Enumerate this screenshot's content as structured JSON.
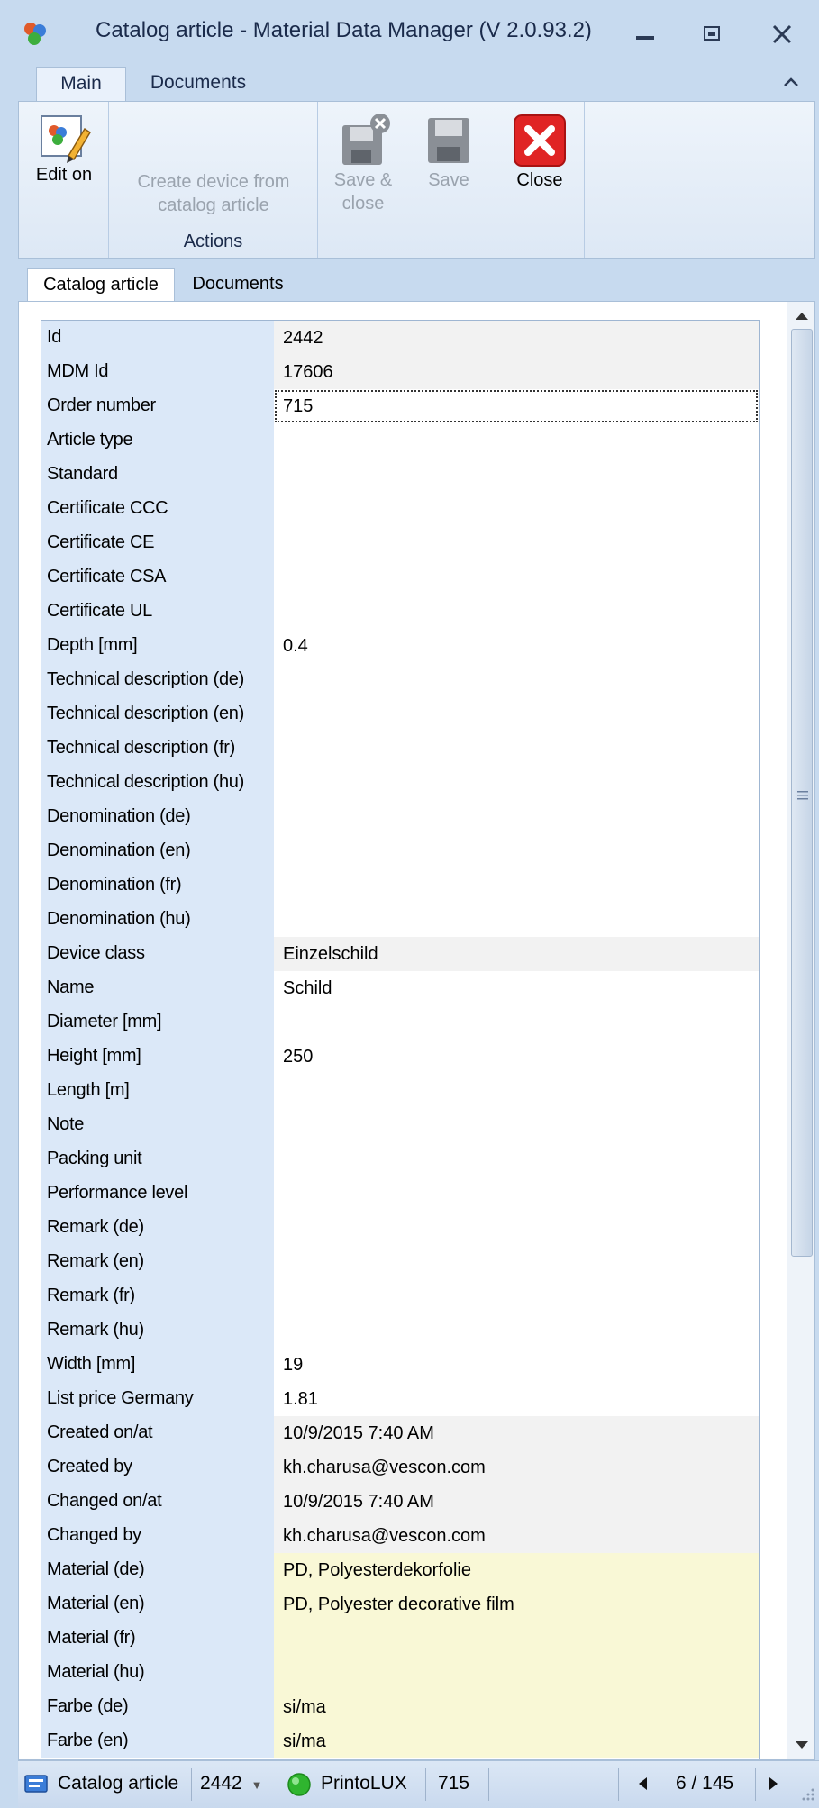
{
  "window": {
    "title": "Catalog article - Material Data Manager (V 2.0.93.2)"
  },
  "ribbon": {
    "tabs": [
      "Main",
      "Documents"
    ],
    "buttons": {
      "edit_on": "Edit on",
      "create_device_line1": "Create device from",
      "create_device_line2": "catalog article",
      "save_close_line1": "Save &",
      "save_close_line2": "close",
      "save": "Save",
      "close": "Close"
    },
    "group_actions": "Actions"
  },
  "content_tabs": [
    "Catalog article",
    "Documents"
  ],
  "fields": [
    {
      "label": "Id",
      "value": "2442",
      "style": "ro"
    },
    {
      "label": "MDM Id",
      "value": "17606",
      "style": "ro"
    },
    {
      "label": "Order number",
      "value": "715",
      "style": "focus"
    },
    {
      "label": "Article type",
      "value": "",
      "style": ""
    },
    {
      "label": "Standard",
      "value": "",
      "style": ""
    },
    {
      "label": "Certificate CCC",
      "value": "",
      "style": ""
    },
    {
      "label": "Certificate CE",
      "value": "",
      "style": ""
    },
    {
      "label": "Certificate CSA",
      "value": "",
      "style": ""
    },
    {
      "label": "Certificate UL",
      "value": "",
      "style": ""
    },
    {
      "label": "Depth [mm]",
      "value": "0.4",
      "style": ""
    },
    {
      "label": "Technical description (de)",
      "value": "",
      "style": ""
    },
    {
      "label": "Technical description (en)",
      "value": "",
      "style": ""
    },
    {
      "label": "Technical description (fr)",
      "value": "",
      "style": ""
    },
    {
      "label": "Technical description (hu)",
      "value": "",
      "style": ""
    },
    {
      "label": "Denomination (de)",
      "value": "",
      "style": ""
    },
    {
      "label": "Denomination (en)",
      "value": "",
      "style": ""
    },
    {
      "label": "Denomination (fr)",
      "value": "",
      "style": ""
    },
    {
      "label": "Denomination (hu)",
      "value": "",
      "style": ""
    },
    {
      "label": "Device class",
      "value": "Einzelschild",
      "style": "ro"
    },
    {
      "label": "Name",
      "value": "Schild",
      "style": ""
    },
    {
      "label": "Diameter [mm]",
      "value": "",
      "style": ""
    },
    {
      "label": "Height [mm]",
      "value": "250",
      "style": ""
    },
    {
      "label": "Length [m]",
      "value": "",
      "style": ""
    },
    {
      "label": "Note",
      "value": "",
      "style": ""
    },
    {
      "label": "Packing unit",
      "value": "",
      "style": ""
    },
    {
      "label": "Performance level",
      "value": "",
      "style": ""
    },
    {
      "label": "Remark (de)",
      "value": "",
      "style": ""
    },
    {
      "label": "Remark (en)",
      "value": "",
      "style": ""
    },
    {
      "label": "Remark (fr)",
      "value": "",
      "style": ""
    },
    {
      "label": "Remark (hu)",
      "value": "",
      "style": ""
    },
    {
      "label": "Width [mm]",
      "value": "19",
      "style": ""
    },
    {
      "label": "List price Germany",
      "value": "1.81",
      "style": ""
    },
    {
      "label": "Created on/at",
      "value": "10/9/2015 7:40 AM",
      "style": "ro"
    },
    {
      "label": "Created by",
      "value": "kh.charusa@vescon.com",
      "style": "ro"
    },
    {
      "label": "Changed on/at",
      "value": "10/9/2015 7:40 AM",
      "style": "ro"
    },
    {
      "label": "Changed by",
      "value": "kh.charusa@vescon.com",
      "style": "ro"
    },
    {
      "label": "Material (de)",
      "value": "PD, Polyesterdekorfolie",
      "style": "mat"
    },
    {
      "label": "Material (en)",
      "value": "PD, Polyester decorative film",
      "style": "mat"
    },
    {
      "label": "Material (fr)",
      "value": "",
      "style": "mat"
    },
    {
      "label": "Material (hu)",
      "value": "",
      "style": "mat"
    },
    {
      "label": "Farbe (de)",
      "value": "si/ma",
      "style": "mat"
    },
    {
      "label": "Farbe (en)",
      "value": "si/ma",
      "style": "mat"
    }
  ],
  "statusbar": {
    "entity": "Catalog article",
    "id": "2442",
    "manufacturer": "PrintoLUX",
    "order_number": "715",
    "position": "6 / 145"
  },
  "colors": {
    "window_bg": "#c7daef",
    "label_bg": "#dbe8f8",
    "readonly_bg": "#f2f2f2",
    "material_bg": "#f9f8d6",
    "status_green": "#2fb52f",
    "close_red": "#e02424"
  },
  "icons": {
    "app": "app-icon",
    "edit": "edit-icon",
    "save_close": "save-close-icon",
    "save": "save-icon",
    "close": "close-icon",
    "catalog": "catalog-icon",
    "status": "green-status-icon"
  }
}
